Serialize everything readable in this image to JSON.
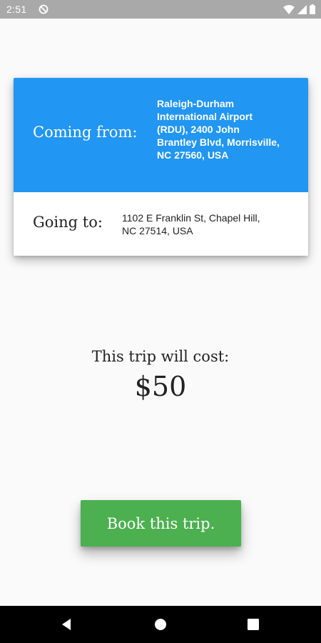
{
  "status_bar": {
    "time": "2:51",
    "icons": [
      "dnd-icon",
      "wifi-icon",
      "signal-icon",
      "battery-icon"
    ]
  },
  "trip": {
    "from_label": "Coming from:",
    "from_address": "Raleigh-Durham International Airport (RDU), 2400 John Brantley Blvd, Morrisville, NC 27560, USA",
    "to_label": "Going to:",
    "to_address": "1102 E Franklin St, Chapel Hill, NC 27514, USA"
  },
  "cost": {
    "label": "This trip will cost:",
    "value": "$50"
  },
  "book_button": {
    "label": "Book this trip."
  },
  "nav_bar": {
    "icons": [
      "back-icon",
      "home-icon",
      "recents-icon"
    ]
  },
  "colors": {
    "from_background": "#2196f3",
    "button": "#4caf50",
    "status_bar": "#a9a9a9",
    "nav_bar": "#000000"
  }
}
